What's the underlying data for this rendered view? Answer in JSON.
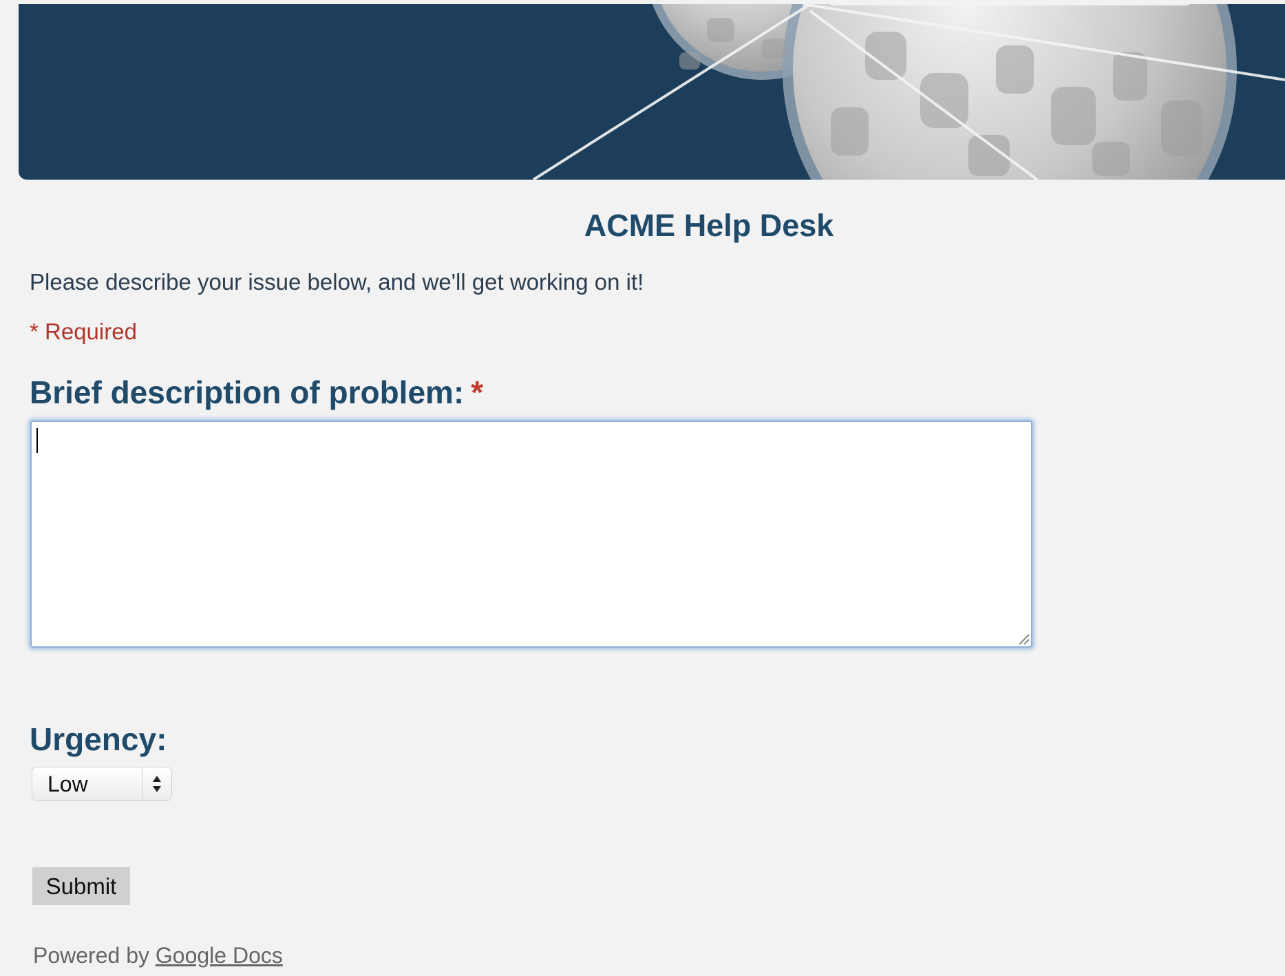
{
  "form": {
    "title": "ACME Help Desk",
    "description": "Please describe your issue below, and we'll get working on it!",
    "required_note": "* Required"
  },
  "questions": [
    {
      "label": "Brief description of problem:",
      "required_marker": "*",
      "value": ""
    },
    {
      "label": "Urgency:",
      "selected_option": "Low"
    }
  ],
  "submit_label": "Submit",
  "footer": {
    "prefix": "Powered by",
    "link_text": "Google Docs"
  },
  "colors": {
    "banner": "#1c3e5a",
    "heading": "#1f4a6a",
    "required": "#b3362a",
    "focus_ring": "#8fb0d6"
  },
  "icons": {
    "select_arrows": "up-down-arrows-icon",
    "resize": "resize-grip-icon"
  }
}
